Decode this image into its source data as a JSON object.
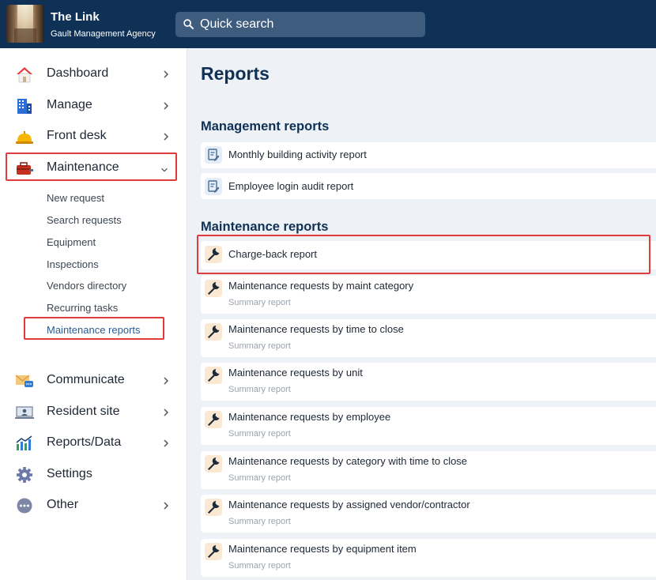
{
  "header": {
    "org_title": "The Link",
    "org_subtitle": "Gault Management Agency",
    "search_label": "Quick search"
  },
  "sidebar": {
    "items": [
      {
        "label": "Dashboard",
        "icon": "home-icon"
      },
      {
        "label": "Manage",
        "icon": "building-icon"
      },
      {
        "label": "Front desk",
        "icon": "service-bell-icon"
      },
      {
        "label": "Maintenance",
        "icon": "toolbox-icon",
        "expanded": true
      },
      {
        "label": "Communicate",
        "icon": "envelope-chat-icon"
      },
      {
        "label": "Resident site",
        "icon": "computer-user-icon"
      },
      {
        "label": "Reports/Data",
        "icon": "chart-icon"
      },
      {
        "label": "Settings",
        "icon": "gear-icon"
      },
      {
        "label": "Other",
        "icon": "more-icon"
      }
    ],
    "maintenance_submenu": [
      "New request",
      "Search requests",
      "Equipment",
      "Inspections",
      "Vendors directory",
      "Recurring tasks",
      "Maintenance reports"
    ]
  },
  "main": {
    "page_title": "Reports",
    "management_section": {
      "title": "Management reports",
      "items": [
        {
          "title": "Monthly building activity report"
        },
        {
          "title": "Employee login audit report"
        }
      ]
    },
    "maintenance_section": {
      "title": "Maintenance reports",
      "items": [
        {
          "title": "Charge-back report",
          "subtitle": ""
        },
        {
          "title": "Maintenance requests by maint category",
          "subtitle": "Summary report"
        },
        {
          "title": "Maintenance requests by time to close",
          "subtitle": "Summary report"
        },
        {
          "title": "Maintenance requests by unit",
          "subtitle": "Summary report"
        },
        {
          "title": "Maintenance requests by employee",
          "subtitle": "Summary report"
        },
        {
          "title": "Maintenance requests by category with time to close",
          "subtitle": "Summary report"
        },
        {
          "title": "Maintenance requests by assigned vendor/contractor",
          "subtitle": "Summary report"
        },
        {
          "title": "Maintenance requests by equipment item",
          "subtitle": "Summary report"
        }
      ]
    }
  },
  "colors": {
    "header_bg": "#0f3156",
    "highlight": "#e03c3c",
    "active_link": "#2b5c8f"
  }
}
